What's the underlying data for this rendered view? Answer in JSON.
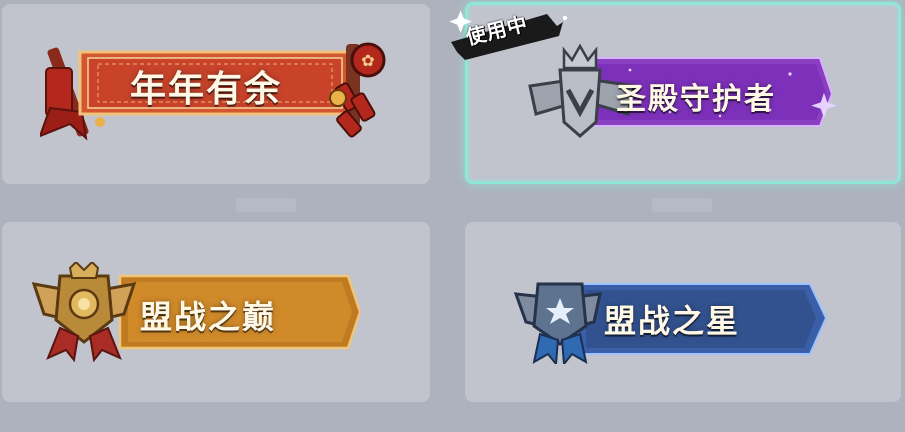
{
  "titles": [
    {
      "name": "年年有余",
      "state": "available",
      "theme": "red-firecracker",
      "color": "#c24a2c"
    },
    {
      "name": "圣殿守护者",
      "state": "in-use",
      "theme": "purple-silver-wings",
      "color": "#8a3fc0"
    },
    {
      "name": "盟战之巅",
      "state": "available",
      "theme": "gold-shield",
      "color": "#c07a20"
    },
    {
      "name": "盟战之星",
      "state": "available",
      "theme": "blue-steel",
      "color": "#3a5ea8"
    }
  ],
  "in_use_label": "使用中",
  "colors": {
    "page_bg": "#aeb2bd",
    "card_bg": "#c1c4cd",
    "selected_border": "#8fe7d8"
  }
}
